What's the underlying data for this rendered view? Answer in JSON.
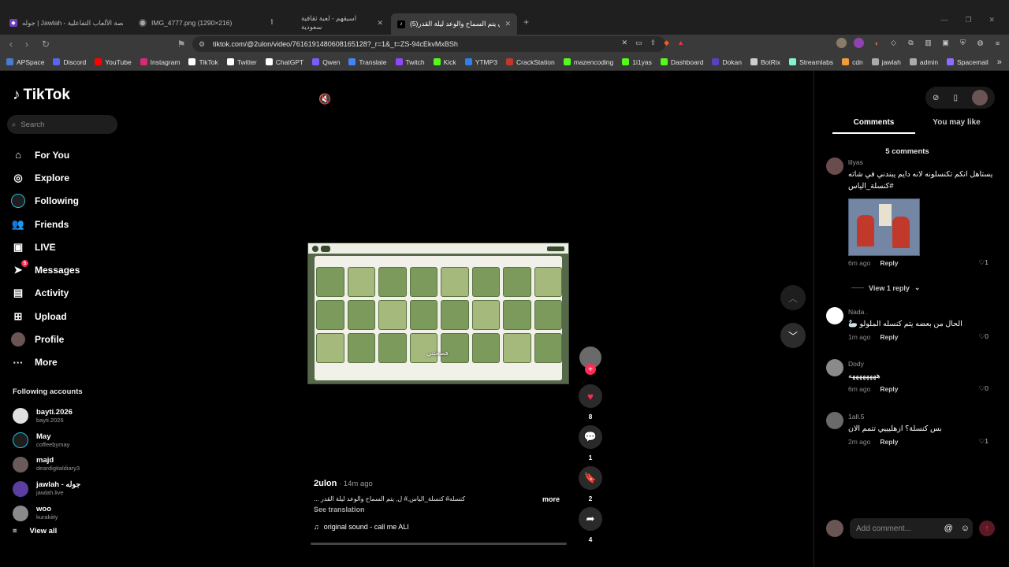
{
  "browser": {
    "tabs": [
      {
        "title": "جوله | Jawlah - منصة الألعاب التفاعلية",
        "favicon": "jawlah-icon",
        "active": false
      },
      {
        "title": "IMG_4777.png (1290×216)",
        "favicon": "globe-icon",
        "active": false
      },
      {
        "title": "اسيقهم - لعبة ثقافية سعودية",
        "favicon": "asqahum-icon",
        "active": false
      },
      {
        "title": "(5)ان يتم السماح والوعد ليلة القدر",
        "favicon": "tiktok-icon",
        "active": true
      }
    ],
    "new_tab_label": "+",
    "url": "tiktok.com/@2ulon/video/7616191480608165128?_r=1&_t=ZS-94cEkvMxBSh",
    "bookmarks": [
      {
        "label": "APSpace",
        "color": "#4a7bd0"
      },
      {
        "label": "Discord",
        "color": "#5865f2"
      },
      {
        "label": "YouTube",
        "color": "#ff0000"
      },
      {
        "label": "Instagram",
        "color": "#d62976"
      },
      {
        "label": "TikTok",
        "color": "#ffffff"
      },
      {
        "label": "Twitter",
        "color": "#ffffff"
      },
      {
        "label": "ChatGPT",
        "color": "#ffffff"
      },
      {
        "label": "Qwen",
        "color": "#7c5cff"
      },
      {
        "label": "Translate",
        "color": "#4285f4"
      },
      {
        "label": "Twitch",
        "color": "#9146ff"
      },
      {
        "label": "Kick",
        "color": "#53fc18"
      },
      {
        "label": "YTMP3",
        "color": "#2f80ed"
      },
      {
        "label": "CrackStation",
        "color": "#c0392b"
      },
      {
        "label": "mazencoding",
        "color": "#53fc18"
      },
      {
        "label": "1i1yas",
        "color": "#53fc18"
      },
      {
        "label": "Dashboard",
        "color": "#53fc18"
      },
      {
        "label": "Dokan",
        "color": "#5a3fc0"
      },
      {
        "label": "BotRix",
        "color": "#cccccc"
      },
      {
        "label": "Streamlabs",
        "color": "#80f5d2"
      },
      {
        "label": "cdn",
        "color": "#f29c38"
      },
      {
        "label": "jawlah",
        "color": "#aaaaaa"
      },
      {
        "label": "admin",
        "color": "#aaaaaa"
      },
      {
        "label": "Spacemail",
        "color": "#8e6cff"
      }
    ],
    "overflow_label": "»"
  },
  "sidebar": {
    "logo": "TikTok",
    "search_placeholder": "Search",
    "nav": [
      {
        "label": "For You",
        "icon": "home-icon"
      },
      {
        "label": "Explore",
        "icon": "compass-icon"
      },
      {
        "label": "Following",
        "icon": "following-avatar-icon"
      },
      {
        "label": "Friends",
        "icon": "friends-icon"
      },
      {
        "label": "LIVE",
        "icon": "live-icon"
      },
      {
        "label": "Messages",
        "icon": "send-icon",
        "badge": "5"
      },
      {
        "label": "Activity",
        "icon": "activity-icon"
      },
      {
        "label": "Upload",
        "icon": "upload-icon"
      },
      {
        "label": "Profile",
        "icon": "profile-avatar-icon"
      },
      {
        "label": "More",
        "icon": "more-icon"
      }
    ],
    "following_title": "Following accounts",
    "following": [
      {
        "name": "bayti.2026",
        "handle": "bayti.2026"
      },
      {
        "name": "May",
        "handle": "coffeebymay"
      },
      {
        "name": "majd",
        "handle": "deardigitaldiary3"
      },
      {
        "name": "jawlah - جوله",
        "handle": "jawlah.live"
      },
      {
        "name": "woo",
        "handle": "kurakiity"
      }
    ],
    "view_all": "View all"
  },
  "video": {
    "caption_overlay": "فصحتني",
    "author": "2ulon",
    "time": " · 14m ago",
    "description": "كنسله# كنسلة_الياس,# ل, يتم السماح والوعد ليلة القدر ...",
    "more_label": "more",
    "see_translation": "See translation",
    "sound": "original sound - call me ALI",
    "progress": 0.0
  },
  "actions": {
    "likes": "8",
    "comments": "1",
    "saves": "2",
    "shares": "4"
  },
  "comments_panel": {
    "tabs": [
      "Comments",
      "You may like"
    ],
    "count_label": "5 comments",
    "comments": [
      {
        "user": "lilyas",
        "text": "يستاهل انكم تكنسلونه لانه دايم يبندني في شاته #كنسلة_الياس",
        "time": "6m ago",
        "reply": "Reply",
        "likes": "1",
        "has_image": true
      },
      {
        "user": "Nada .",
        "text": "الحال من بعضه يتم كنسله الملولو 🦢",
        "time": "1m ago",
        "reply": "Reply",
        "likes": "0"
      },
      {
        "user": "Dody",
        "text": "ههههههههه",
        "time": "6m ago",
        "reply": "Reply",
        "likes": "0"
      },
      {
        "user": "1all.5",
        "text": "بس كنسلة؟ ازهليييي تتمم الان",
        "time": "2m ago",
        "reply": "Reply",
        "likes": "1"
      }
    ],
    "view_replies": "View 1 reply",
    "add_comment_placeholder": "Add comment..."
  }
}
